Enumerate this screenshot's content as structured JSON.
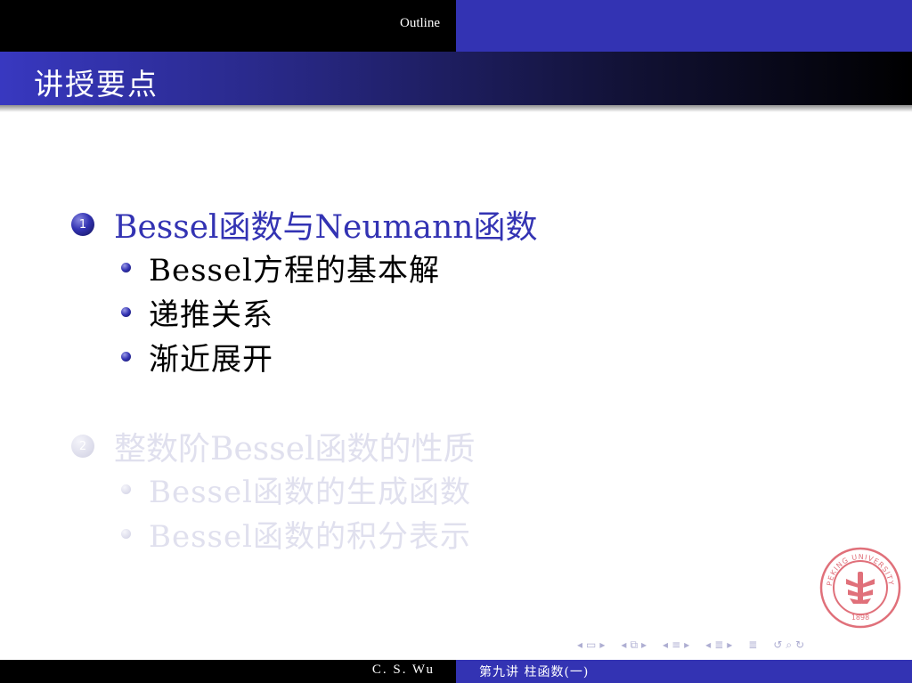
{
  "header": {
    "outline_label": "Outline"
  },
  "frame": {
    "title": "讲授要点"
  },
  "outline": {
    "sections": [
      {
        "number": "1",
        "label": "Bessel函数与Neumann函数",
        "items": [
          "Bessel方程的基本解",
          "递推关系",
          "渐近展开"
        ]
      },
      {
        "number": "2",
        "label": "整数阶Bessel函数的性质",
        "items": [
          "Bessel函数的生成函数",
          "Bessel函数的积分表示"
        ]
      }
    ]
  },
  "logo": {
    "text": "PEKING UNIVERSITY",
    "year": "1898",
    "color": "#e0707a"
  },
  "navigation": {
    "icons": [
      "nav-frame-icon",
      "nav-subsection-icon",
      "nav-section-icon",
      "nav-document-icon",
      "nav-appendix-icon",
      "nav-search-icon"
    ]
  },
  "footer": {
    "author": "C. S. Wu",
    "short_title": "第九讲  柱函数(一)"
  },
  "colors": {
    "structure": "#3333b3",
    "header_black": "#000000",
    "inactive_text": "#e0e0ee"
  }
}
